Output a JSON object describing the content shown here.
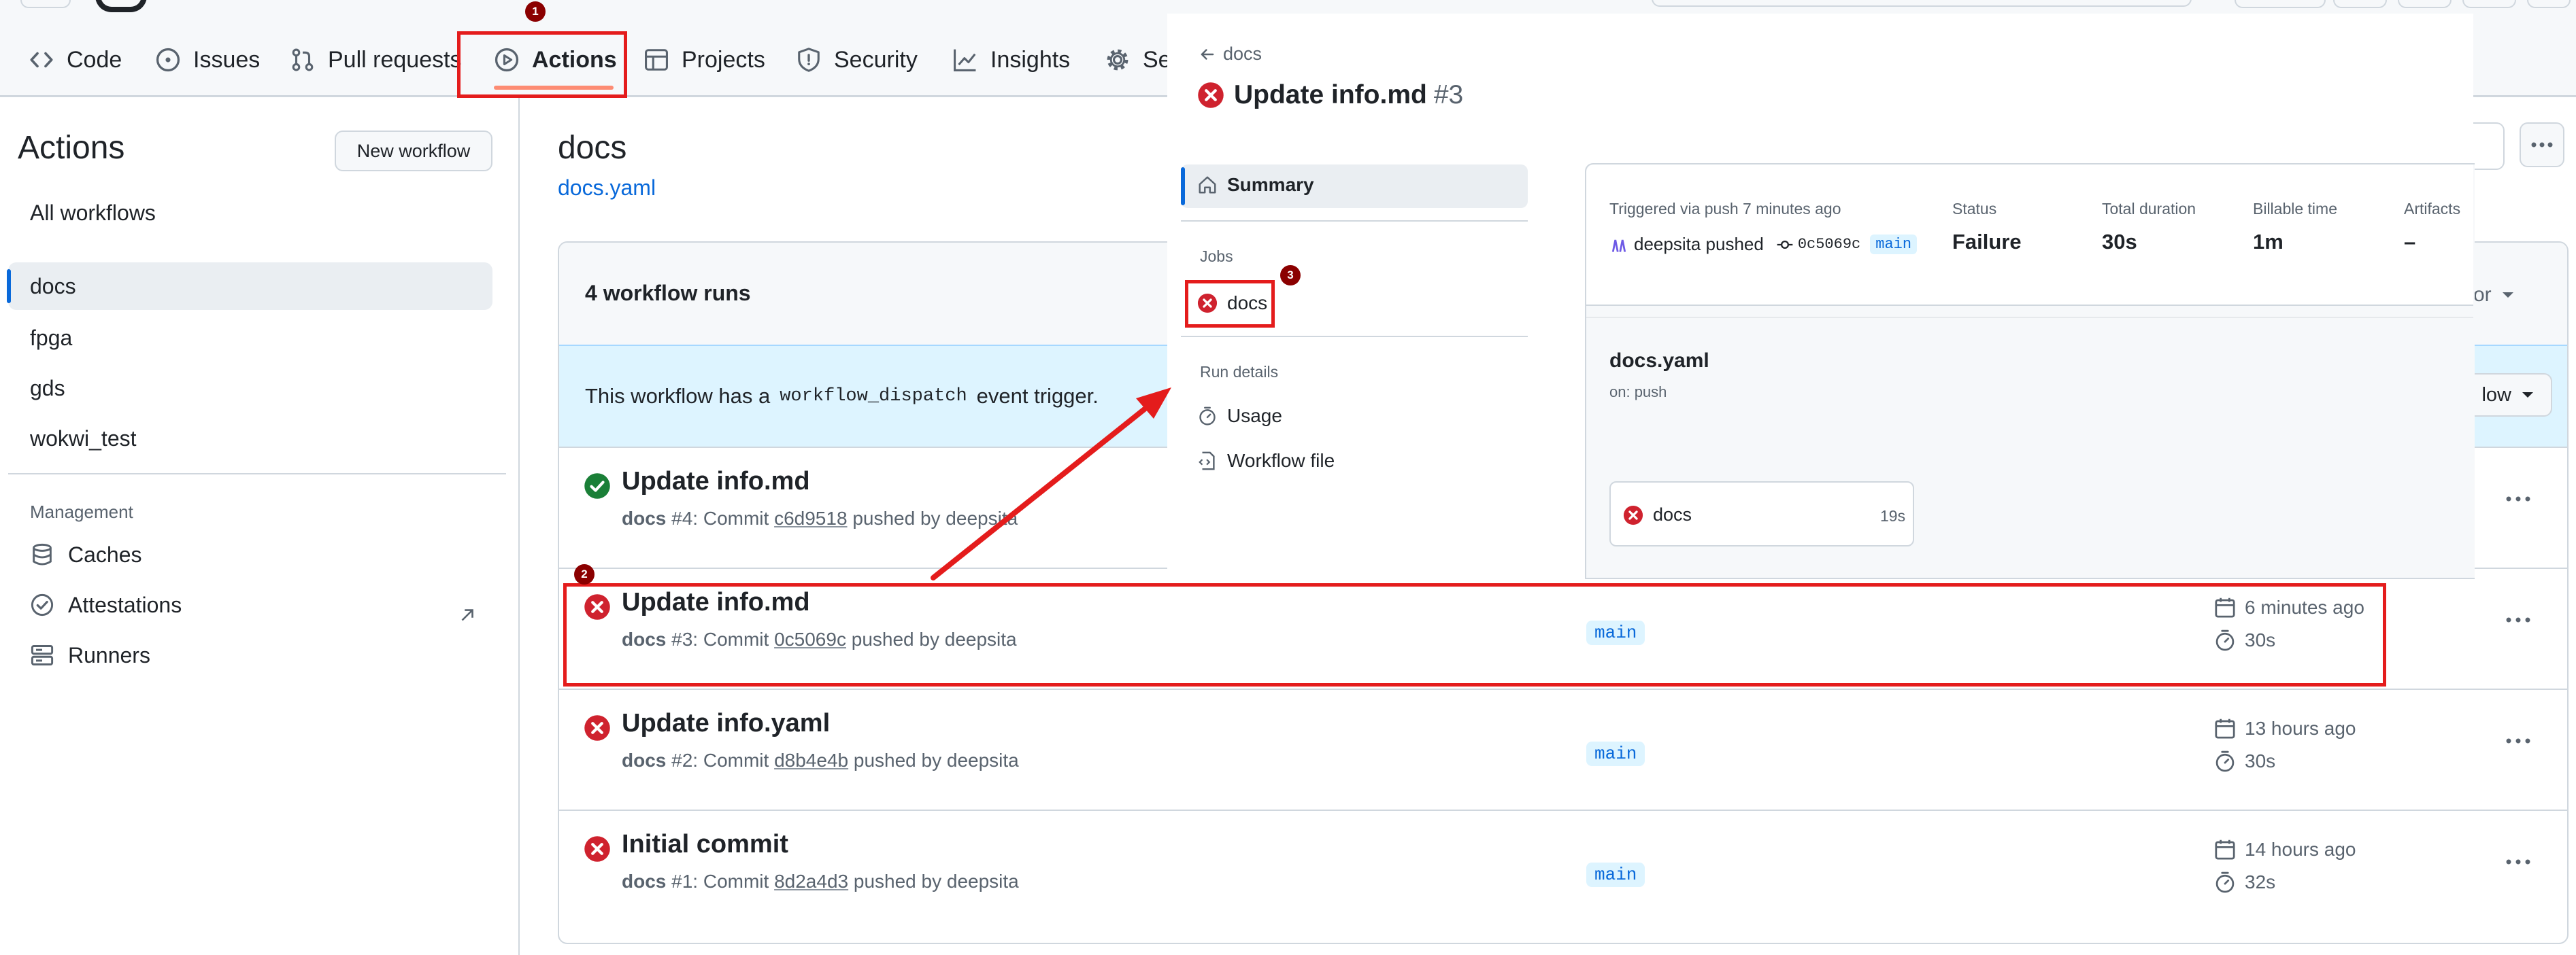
{
  "nav": {
    "code": "Code",
    "issues": "Issues",
    "pull_requests": "Pull requests",
    "actions": "Actions",
    "projects": "Projects",
    "security": "Security",
    "insights": "Insights",
    "settings_partial": "Se"
  },
  "sidebar": {
    "title": "Actions",
    "new_workflow": "New workflow",
    "all_workflows": "All workflows",
    "workflows": [
      "docs",
      "fpga",
      "gds",
      "wokwi_test"
    ],
    "management_label": "Management",
    "management": [
      "Caches",
      "Attestations",
      "Runners"
    ]
  },
  "main": {
    "title": "docs",
    "file_link": "docs.yaml",
    "runs_count": "4 workflow runs",
    "partial_filter": "or",
    "dispatch_before": "This workflow has a",
    "dispatch_code": "workflow_dispatch",
    "dispatch_after": "event trigger.",
    "dispatch_partial_btn": "low",
    "runs": [
      {
        "title": "Update info.md",
        "workflow": "docs",
        "number": "#4",
        "commit_label": "Commit",
        "commit": "c6d9518",
        "pushed_by": "pushed by deepsita",
        "status": "success",
        "branch": "",
        "time": "",
        "duration": ""
      },
      {
        "title": "Update info.md",
        "workflow": "docs",
        "number": "#3",
        "commit_label": "Commit",
        "commit": "0c5069c",
        "pushed_by": "pushed by deepsita",
        "status": "failure",
        "branch": "main",
        "time": "6 minutes ago",
        "duration": "30s"
      },
      {
        "title": "Update info.yaml",
        "workflow": "docs",
        "number": "#2",
        "commit_label": "Commit",
        "commit": "d8b4e4b",
        "pushed_by": "pushed by deepsita",
        "status": "failure",
        "branch": "main",
        "time": "13 hours ago",
        "duration": "30s"
      },
      {
        "title": "Initial commit",
        "workflow": "docs",
        "number": "#1",
        "commit_label": "Commit",
        "commit": "8d2a4d3",
        "pushed_by": "pushed by deepsita",
        "status": "failure",
        "branch": "main",
        "time": "14 hours ago",
        "duration": "32s"
      }
    ]
  },
  "overlay": {
    "back_label": "docs",
    "run_title": "Update info.md",
    "run_number": "#3",
    "summary": "Summary",
    "jobs_label": "Jobs",
    "job_name": "docs",
    "run_details_label": "Run details",
    "usage": "Usage",
    "workflow_file": "Workflow file",
    "triggered": "Triggered via push 7 minutes ago",
    "actor": "deepsita pushed",
    "commit": "0c5069c",
    "branch": "main",
    "status_label": "Status",
    "status_value": "Failure",
    "duration_label": "Total duration",
    "duration_value": "30s",
    "billable_label": "Billable time",
    "billable_value": "1m",
    "artifacts_label": "Artifacts",
    "artifacts_value": "–",
    "graph_file": "docs.yaml",
    "graph_on": "on: push",
    "graph_job": "docs",
    "graph_job_time": "19s"
  },
  "annotations": {
    "badge1": "1",
    "badge2": "2",
    "badge3": "3"
  },
  "colors": {
    "failure": "#cf222e",
    "success": "#1a7f37",
    "link": "#0969da",
    "annotation": "#e41c1c"
  }
}
